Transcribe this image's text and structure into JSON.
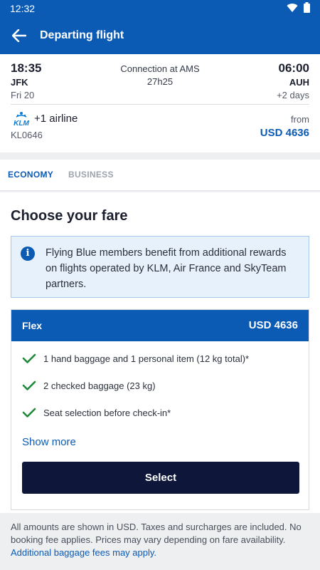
{
  "status_bar": {
    "time": "12:32",
    "icons": [
      "wifi-icon",
      "battery-icon"
    ]
  },
  "app_bar": {
    "title": "Departing flight",
    "back_icon": "arrow-left-icon"
  },
  "flight": {
    "departure": {
      "time": "18:35",
      "airport": "JFK",
      "date": "Fri 20"
    },
    "connection": {
      "text": "Connection at AMS",
      "duration": "27h25"
    },
    "arrival": {
      "time": "06:00",
      "airport": "AUH",
      "days": "+2 days"
    },
    "airline": {
      "logo": "KLM",
      "extra": "+1 airline",
      "flight_number": "KL0646"
    },
    "price": {
      "prefix": "from",
      "value": "USD 4636"
    }
  },
  "tabs": [
    {
      "label": "ECONOMY",
      "active": true
    },
    {
      "label": "BUSINESS",
      "active": false
    }
  ],
  "content": {
    "title": "Choose your fare",
    "info": {
      "icon": "info-icon",
      "text": "Flying Blue members benefit from additional rewards on flights operated by KLM, Air France and SkyTeam partners."
    },
    "fare": {
      "name": "Flex",
      "price": "USD 4636",
      "features": [
        "1 hand baggage and 1 personal item (12 kg total)*",
        "2 checked baggage (23 kg)",
        "Seat selection before check-in*"
      ],
      "show_more": "Show more",
      "select": "Select"
    }
  },
  "footer": {
    "text": "All amounts are shown in USD. Taxes and surcharges are included. No booking fee applies. Prices may vary depending on fare availability.",
    "link": "Additional baggage fees may apply."
  },
  "colors": {
    "brand_blue": "#0b5bb5",
    "dark_button": "#0e1739",
    "check_green": "#1e8a3a",
    "info_bg": "#e6f1fc"
  }
}
